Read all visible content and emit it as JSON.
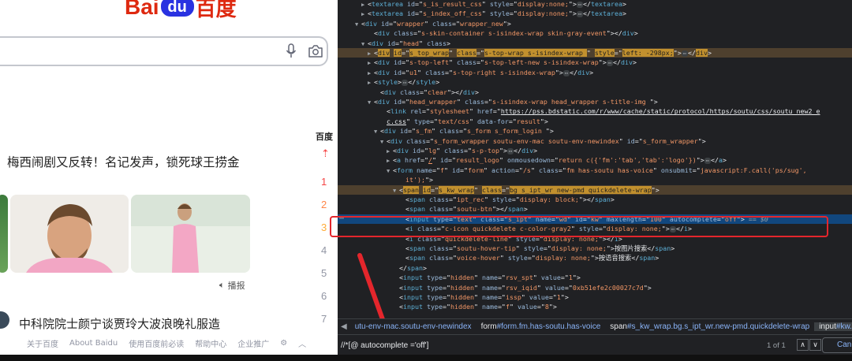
{
  "baidu": {
    "logo_latin": "Bai",
    "logo_paw": "du",
    "logo_cn": "百度",
    "hot_title": "梅西闹剧又反转！名记发声，锁死球王捞金",
    "broadcast_label": "播报",
    "news_title": "中科院院士颜宁谈贾玲大波浪晚礼服造",
    "footer": [
      "关于百度",
      "About Baidu",
      "使用百度前必读",
      "帮助中心",
      "企业推广"
    ]
  },
  "ranking": {
    "header": "百度",
    "pinned": "⇡",
    "numbers": [
      "1",
      "2",
      "3",
      "4",
      "5",
      "6",
      "7"
    ],
    "colors": [
      "#f54545",
      "#ff8547",
      "#ffac38",
      "#9195a3",
      "#9195a3",
      "#9195a3",
      "#9195a3"
    ]
  },
  "devtools": {
    "lines": [
      {
        "indent": 1,
        "tri": "▶",
        "html": "&lt;<span class='tag'>textarea</span> <span class='attr'>id</span>=\"<span class='val'>s_is_result_css</span>\" <span class='attr'>style</span>=\"<span class='val'>display:none;</span>\"&gt;<span class='ellipsis'>⋯</span>&lt;/<span class='tag'>textarea</span>&gt;"
      },
      {
        "indent": 1,
        "tri": "▶",
        "html": "&lt;<span class='tag'>textarea</span> <span class='attr'>id</span>=\"<span class='val'>s_index_off_css</span>\" <span class='attr'>style</span>=\"<span class='val'>display:none;</span>\"&gt;<span class='ellipsis'>⋯</span>&lt;/<span class='tag'>textarea</span>&gt;"
      },
      {
        "indent": 0,
        "tri": "▼",
        "html": "&lt;<span class='tag'>div</span> <span class='attr'>id</span>=\"<span class='val'>wrapper</span>\" <span class='attr'>class</span>=\"<span class='val'>wrapper_new</span>\"&gt;"
      },
      {
        "indent": 2,
        "tri": "",
        "html": "&lt;<span class='tag'>div</span> <span class='attr'>class</span>=\"<span class='val'>s-skin-container s-isindex-wrap skin-gray-event</span>\"&gt;&lt;/<span class='tag'>div</span>&gt;"
      },
      {
        "indent": 1,
        "tri": "▼",
        "html": "&lt;<span class='tag'>div</span> <span class='attr'>id</span>=\"<span class='val'>head</span>\" <span class='attr'>class</span>&gt;"
      },
      {
        "indent": 2,
        "tri": "▶",
        "cls": "hl-orange",
        "html": "&lt;<span class='tag'>div</span> <span class='attr'>id</span>=\"<span class='val'>s_top_wrap</span>\" <span class='attr'>class</span>=\"<span class='val'>s-top-wrap s-isindex-wrap </span>\" <span class='attr'>style</span>=\"<span class='val'>left: -298px;</span>\"&gt;<span class='ellipsis'>⋯</span>&lt;/<span class='tag'>div</span>&gt;"
      },
      {
        "indent": 2,
        "tri": "▶",
        "html": "&lt;<span class='tag'>div</span> <span class='attr'>id</span>=\"<span class='val'>s-top-left</span>\" <span class='attr'>class</span>=\"<span class='val'>s-top-left-new s-isindex-wrap</span>\"&gt;<span class='ellipsis'>⋯</span>&lt;/<span class='tag'>div</span>&gt;"
      },
      {
        "indent": 2,
        "tri": "▶",
        "html": "&lt;<span class='tag'>div</span> <span class='attr'>id</span>=\"<span class='val'>u1</span>\" <span class='attr'>class</span>=\"<span class='val'>s-top-right s-isindex-wrap</span>\"&gt;<span class='ellipsis'>⋯</span>&lt;/<span class='tag'>div</span>&gt;"
      },
      {
        "indent": 2,
        "tri": "▶",
        "html": "&lt;<span class='tag'>style</span>&gt;<span class='ellipsis'>⋯</span>&lt;/<span class='tag'>style</span>&gt;"
      },
      {
        "indent": 3,
        "tri": "",
        "html": "&lt;<span class='tag'>div</span> <span class='attr'>class</span>=\"<span class='val'>clear</span>\"&gt;&lt;/<span class='tag'>div</span>&gt;"
      },
      {
        "indent": 2,
        "tri": "▼",
        "html": "&lt;<span class='tag'>div</span> <span class='attr'>id</span>=\"<span class='val'>head_wrapper</span>\" <span class='attr'>class</span>=\"<span class='val'>s-isindex-wrap head_wrapper s-title-img </span>\"&gt;"
      },
      {
        "indent": 4,
        "tri": "",
        "html": "&lt;<span class='tag'>link</span> <span class='attr'>rel</span>=\"<span class='val'>stylesheet</span>\" <span class='attr'>href</span>=\"<span class='val' style='text-decoration:underline;color:#e8eaed'>https://pss.bdstatic.com/r/www/cache/static/protocol/https/soutu/css/soutu_new2 e</span>"
      },
      {
        "indent": 4,
        "tri": "",
        "html": "<span class='val' style='text-decoration:underline;color:#e8eaed'>c.css</span>\" <span class='attr'>type</span>=\"<span class='val'>text/css</span>\" <span class='attr'>data-for</span>=\"<span class='val'>result</span>\"&gt;"
      },
      {
        "indent": 3,
        "tri": "▼",
        "html": "&lt;<span class='tag'>div</span> <span class='attr'>id</span>=\"<span class='val'>s_fm</span>\" <span class='attr'>class</span>=\"<span class='val'>s_form s_form_login </span>\"&gt;"
      },
      {
        "indent": 4,
        "tri": "▼",
        "html": "&lt;<span class='tag'>div</span> <span class='attr'>class</span>=\"<span class='val'>s_form_wrapper  soutu-env-mac soutu-env-newindex</span>\" <span class='attr'>id</span>=\"<span class='val'>s_form_wrapper</span>\"&gt;"
      },
      {
        "indent": 5,
        "tri": "▶",
        "html": "&lt;<span class='tag'>div</span> <span class='attr'>id</span>=\"<span class='val'>lg</span>\" <span class='attr'>class</span>=\"<span class='val'>s-p-top</span>\"&gt;<span class='ellipsis'>⋯</span>&lt;/<span class='tag'>div</span>&gt;"
      },
      {
        "indent": 5,
        "tri": "▶",
        "html": "&lt;<span class='tag'>a</span> <span class='attr'>href</span>=\"<span class='val' style='text-decoration:underline'>/</span>\" <span class='attr'>id</span>=\"<span class='val'>result_logo</span>\" <span class='attr'>onmousedown</span>=\"<span class='val'>return c({'fm':'tab','tab':'logo'})</span>\"&gt;<span class='ellipsis'>⋯</span>&lt;/<span class='tag'>a</span>&gt;"
      },
      {
        "indent": 5,
        "tri": "▼",
        "html": "&lt;<span class='tag'>form</span> <span class='attr'>name</span>=\"<span class='val'>f</span>\" <span class='attr'>id</span>=\"<span class='val'>form</span>\" <span class='attr'>action</span>=\"<span class='val'>/s</span>\" <span class='attr'>class</span>=\"<span class='val'>fm  has-soutu has-voice</span>\" <span class='attr'>onsubmit</span>=\"<span class='val'>javascript:F.call('ps/sug',</span>"
      },
      {
        "indent": 7,
        "tri": "",
        "html": "<span class='val'>it');</span>\"&gt;"
      },
      {
        "indent": 6,
        "tri": "▼",
        "cls": "hl-orange",
        "html": "&lt;<span class='tag'>span</span> <span class='attr'>id</span>=\"<span class='val'>s_kw_wrap</span>\" <span class='attr'>class</span>=\"<span class='val'>bg s_ipt_wr new-pmd quickdelete-wrap</span>\"&gt;"
      },
      {
        "indent": 7,
        "tri": "",
        "html": "&lt;<span class='tag'>span</span> <span class='attr'>class</span>=\"<span class='val'>ipt_rec</span>\" <span class='attr'>style</span>=\"<span class='val'>display: block;</span>\"&gt;&lt;/<span class='tag'>span</span>&gt;"
      },
      {
        "indent": 7,
        "tri": "",
        "html": "&lt;<span class='tag'>span</span> <span class='attr'>class</span>=\"<span class='val'>soutu-btn</span>\"&gt;&lt;/<span class='tag'>span</span>&gt;"
      },
      {
        "indent": 7,
        "tri": "",
        "cls": "sel-row",
        "html": "<span class='hl-inline'>&lt;<span class='tag'>input</span> <span class='attr'>type</span>=\"<span class='val'>text</span>\" <span class='attr'>class</span>=\"<span class='val'>s_ipt</span>\" <span class='attr'>name</span>=\"<span class='val'>wd</span>\" <span class='attr'>id</span>=\"<span class='val'>kw</span>\" <span class='attr'>maxlength</span>=\"<span class='val'>100</span>\" <span class='attr'>autocomplete</span>=\"<span class='val'>off</span>\"&gt;</span> <span class='dollar'>== $0</span>"
      },
      {
        "indent": 7,
        "tri": "",
        "html": "&lt;<span class='tag'>i</span> <span class='attr'>class</span>=\"<span class='val'>c-icon quickdelete c-color-gray2</span>\" <span class='attr'>style</span>=\"<span class='val'>display: none;</span>\"&gt;<span class='ellipsis'>⋯</span>&lt;/<span class='tag'>i</span>&gt;"
      },
      {
        "indent": 7,
        "tri": "",
        "html": "&lt;<span class='tag'>i</span> <span class='attr'>class</span>=\"<span class='val'>quickdelete-line</span>\" <span class='attr'>style</span>=\"<span class='val'>display: none;</span>\"&gt;&lt;/<span class='tag'>i</span>&gt;"
      },
      {
        "indent": 7,
        "tri": "",
        "html": "&lt;<span class='tag'>span</span> <span class='attr'>class</span>=\"<span class='val'>soutu-hover-tip</span>\" <span class='attr'>style</span>=\"<span class='val'>display: none;</span>\"&gt;按图片搜索&lt;/<span class='tag'>span</span>&gt;"
      },
      {
        "indent": 7,
        "tri": "",
        "html": "&lt;<span class='tag'>span</span> <span class='attr'>class</span>=\"<span class='val'>voice-hover</span>\" <span class='attr'>style</span>=\"<span class='val'>display: none;</span>\"&gt;按语音搜索&lt;/<span class='tag'>span</span>&gt;"
      },
      {
        "indent": 6,
        "tri": "",
        "html": "&lt;/<span class='tag'>span</span>&gt;"
      },
      {
        "indent": 6,
        "tri": "",
        "html": "&lt;<span class='tag'>input</span> <span class='attr'>type</span>=\"<span class='val'>hidden</span>\" <span class='attr'>name</span>=\"<span class='val'>rsv_spt</span>\" <span class='attr'>value</span>=\"<span class='val'>1</span>\"&gt;"
      },
      {
        "indent": 6,
        "tri": "",
        "html": "&lt;<span class='tag'>input</span> <span class='attr'>type</span>=\"<span class='val'>hidden</span>\" <span class='attr'>name</span>=\"<span class='val'>rsv_iqid</span>\" <span class='attr'>value</span>=\"<span class='val'>0xb51efe2c00027c7d</span>\"&gt;"
      },
      {
        "indent": 6,
        "tri": "",
        "html": "&lt;<span class='tag'>input</span> <span class='attr'>type</span>=\"<span class='val'>hidden</span>\" <span class='attr'>name</span>=\"<span class='val'>issp</span>\" <span class='attr'>value</span>=\"<span class='val'>1</span>\"&gt;"
      },
      {
        "indent": 6,
        "tri": "",
        "html": "&lt;<span class='tag'>input</span> <span class='attr'>type</span>=\"<span class='val'>hidden</span>\" <span class='attr'>name</span>=\"<span class='val'>f</span>\" <span class='attr'>value</span>=\"<span class='val'>8</span>\"&gt;"
      }
    ],
    "selected_marker": "⋯",
    "breadcrumbs": [
      {
        "tag": "div",
        "cls": ".s_form_wrapper.soutu-env-mac.soutu-env-newindex",
        "display": "utu-env-mac.soutu-env-newindex"
      },
      {
        "tag": "form",
        "cls": "#form.fm.has-soutu.has-voice",
        "display": "#form.fm.has-soutu.has-voice"
      },
      {
        "tag": "span",
        "cls": "#s_kw_wrap.bg.s_ipt_wr.new-pmd.quickdelete-wrap",
        "display": "#s_kw_wrap.bg.s_ipt_wr.new-pmd.quickdelete-wrap"
      },
      {
        "tag": "input",
        "cls": "#kw.s_ipt",
        "display": "#kw.s_i"
      }
    ],
    "find_query": "//*[@ autocomplete ='off']",
    "find_count": "1 of 1",
    "find_prev": "∧",
    "find_next": "∨",
    "cancel_label": "Can"
  }
}
